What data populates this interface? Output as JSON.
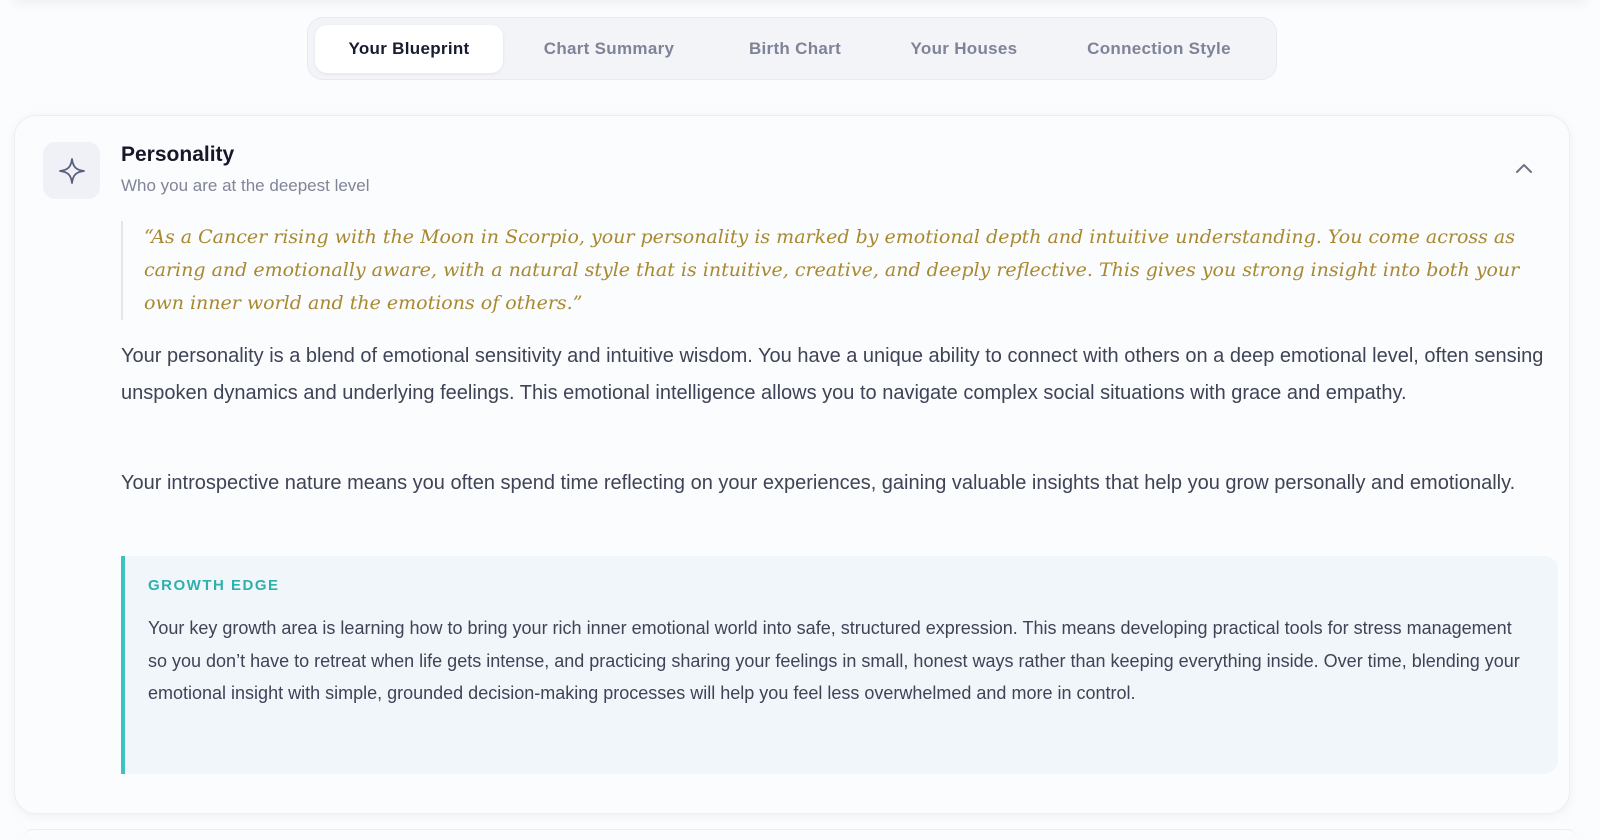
{
  "tabs": [
    {
      "label": "Your Blueprint",
      "active": true
    },
    {
      "label": "Chart Summary",
      "active": false
    },
    {
      "label": "Birth Chart",
      "active": false
    },
    {
      "label": "Your Houses",
      "active": false
    },
    {
      "label": "Connection Style",
      "active": false
    }
  ],
  "section": {
    "icon": "sparkle-icon",
    "collapse_icon": "chevron-up-icon",
    "title": "Personality",
    "subtitle": "Who you are at the deepest level",
    "quote": "“As a Cancer rising with the Moon in Scorpio, your personality is marked by emotional depth and intuitive understanding. You come across as caring and emotionally aware, with a natural style that is intuitive, creative, and deeply reflective. This gives you strong insight into both your own inner world and the emotions of others.”",
    "paragraphs": [
      "Your personality is a blend of emotional sensitivity and intuitive wisdom. You have a unique ability to connect with others on a deep emotional level, often sensing unspoken dynamics and underlying feelings. This emotional intelligence allows you to navigate complex social situations with grace and empathy.",
      "Your introspective nature means you often spend time reflecting on your experiences, gaining valuable insights that help you grow personally and emotionally."
    ],
    "growth_edge": {
      "label": "GROWTH EDGE",
      "text": "Your key growth area is learning how to bring your rich inner emotional world into safe, structured expression. This means developing practical tools for stress management so you don’t have to retreat when life gets intense, and practicing sharing your feelings in small, honest ways rather than keeping everything inside. Over time, blending your emotional insight with simple, grounded decision-making processes will help you feel less overwhelmed and more in control."
    }
  },
  "colors": {
    "quote": "#a8892f",
    "accent_teal": "#3ec1c1",
    "title": "#161829",
    "body_text": "#3f4356"
  }
}
